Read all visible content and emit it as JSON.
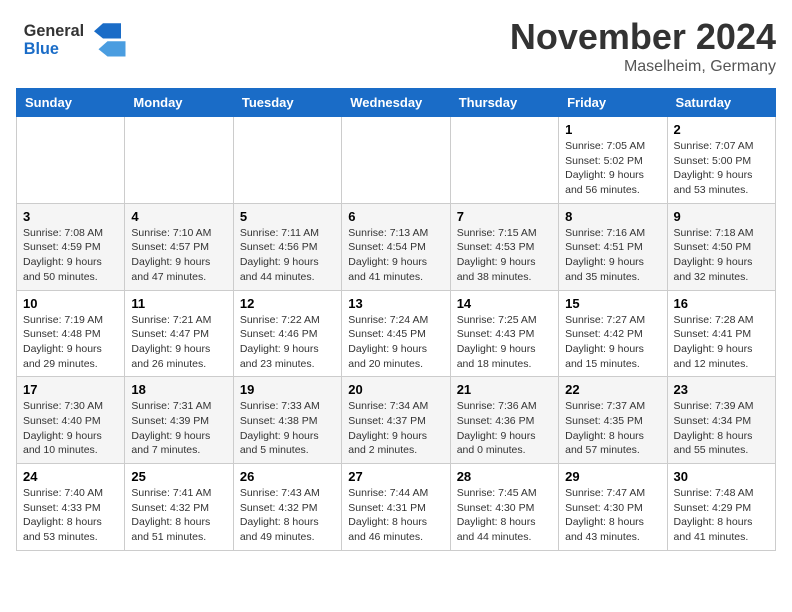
{
  "logo": {
    "line1": "General",
    "line2": "Blue"
  },
  "title": "November 2024",
  "location": "Maselheim, Germany",
  "weekdays": [
    "Sunday",
    "Monday",
    "Tuesday",
    "Wednesday",
    "Thursday",
    "Friday",
    "Saturday"
  ],
  "weeks": [
    [
      {
        "day": "",
        "info": ""
      },
      {
        "day": "",
        "info": ""
      },
      {
        "day": "",
        "info": ""
      },
      {
        "day": "",
        "info": ""
      },
      {
        "day": "",
        "info": ""
      },
      {
        "day": "1",
        "info": "Sunrise: 7:05 AM\nSunset: 5:02 PM\nDaylight: 9 hours and 56 minutes."
      },
      {
        "day": "2",
        "info": "Sunrise: 7:07 AM\nSunset: 5:00 PM\nDaylight: 9 hours and 53 minutes."
      }
    ],
    [
      {
        "day": "3",
        "info": "Sunrise: 7:08 AM\nSunset: 4:59 PM\nDaylight: 9 hours and 50 minutes."
      },
      {
        "day": "4",
        "info": "Sunrise: 7:10 AM\nSunset: 4:57 PM\nDaylight: 9 hours and 47 minutes."
      },
      {
        "day": "5",
        "info": "Sunrise: 7:11 AM\nSunset: 4:56 PM\nDaylight: 9 hours and 44 minutes."
      },
      {
        "day": "6",
        "info": "Sunrise: 7:13 AM\nSunset: 4:54 PM\nDaylight: 9 hours and 41 minutes."
      },
      {
        "day": "7",
        "info": "Sunrise: 7:15 AM\nSunset: 4:53 PM\nDaylight: 9 hours and 38 minutes."
      },
      {
        "day": "8",
        "info": "Sunrise: 7:16 AM\nSunset: 4:51 PM\nDaylight: 9 hours and 35 minutes."
      },
      {
        "day": "9",
        "info": "Sunrise: 7:18 AM\nSunset: 4:50 PM\nDaylight: 9 hours and 32 minutes."
      }
    ],
    [
      {
        "day": "10",
        "info": "Sunrise: 7:19 AM\nSunset: 4:48 PM\nDaylight: 9 hours and 29 minutes."
      },
      {
        "day": "11",
        "info": "Sunrise: 7:21 AM\nSunset: 4:47 PM\nDaylight: 9 hours and 26 minutes."
      },
      {
        "day": "12",
        "info": "Sunrise: 7:22 AM\nSunset: 4:46 PM\nDaylight: 9 hours and 23 minutes."
      },
      {
        "day": "13",
        "info": "Sunrise: 7:24 AM\nSunset: 4:45 PM\nDaylight: 9 hours and 20 minutes."
      },
      {
        "day": "14",
        "info": "Sunrise: 7:25 AM\nSunset: 4:43 PM\nDaylight: 9 hours and 18 minutes."
      },
      {
        "day": "15",
        "info": "Sunrise: 7:27 AM\nSunset: 4:42 PM\nDaylight: 9 hours and 15 minutes."
      },
      {
        "day": "16",
        "info": "Sunrise: 7:28 AM\nSunset: 4:41 PM\nDaylight: 9 hours and 12 minutes."
      }
    ],
    [
      {
        "day": "17",
        "info": "Sunrise: 7:30 AM\nSunset: 4:40 PM\nDaylight: 9 hours and 10 minutes."
      },
      {
        "day": "18",
        "info": "Sunrise: 7:31 AM\nSunset: 4:39 PM\nDaylight: 9 hours and 7 minutes."
      },
      {
        "day": "19",
        "info": "Sunrise: 7:33 AM\nSunset: 4:38 PM\nDaylight: 9 hours and 5 minutes."
      },
      {
        "day": "20",
        "info": "Sunrise: 7:34 AM\nSunset: 4:37 PM\nDaylight: 9 hours and 2 minutes."
      },
      {
        "day": "21",
        "info": "Sunrise: 7:36 AM\nSunset: 4:36 PM\nDaylight: 9 hours and 0 minutes."
      },
      {
        "day": "22",
        "info": "Sunrise: 7:37 AM\nSunset: 4:35 PM\nDaylight: 8 hours and 57 minutes."
      },
      {
        "day": "23",
        "info": "Sunrise: 7:39 AM\nSunset: 4:34 PM\nDaylight: 8 hours and 55 minutes."
      }
    ],
    [
      {
        "day": "24",
        "info": "Sunrise: 7:40 AM\nSunset: 4:33 PM\nDaylight: 8 hours and 53 minutes."
      },
      {
        "day": "25",
        "info": "Sunrise: 7:41 AM\nSunset: 4:32 PM\nDaylight: 8 hours and 51 minutes."
      },
      {
        "day": "26",
        "info": "Sunrise: 7:43 AM\nSunset: 4:32 PM\nDaylight: 8 hours and 49 minutes."
      },
      {
        "day": "27",
        "info": "Sunrise: 7:44 AM\nSunset: 4:31 PM\nDaylight: 8 hours and 46 minutes."
      },
      {
        "day": "28",
        "info": "Sunrise: 7:45 AM\nSunset: 4:30 PM\nDaylight: 8 hours and 44 minutes."
      },
      {
        "day": "29",
        "info": "Sunrise: 7:47 AM\nSunset: 4:30 PM\nDaylight: 8 hours and 43 minutes."
      },
      {
        "day": "30",
        "info": "Sunrise: 7:48 AM\nSunset: 4:29 PM\nDaylight: 8 hours and 41 minutes."
      }
    ]
  ]
}
